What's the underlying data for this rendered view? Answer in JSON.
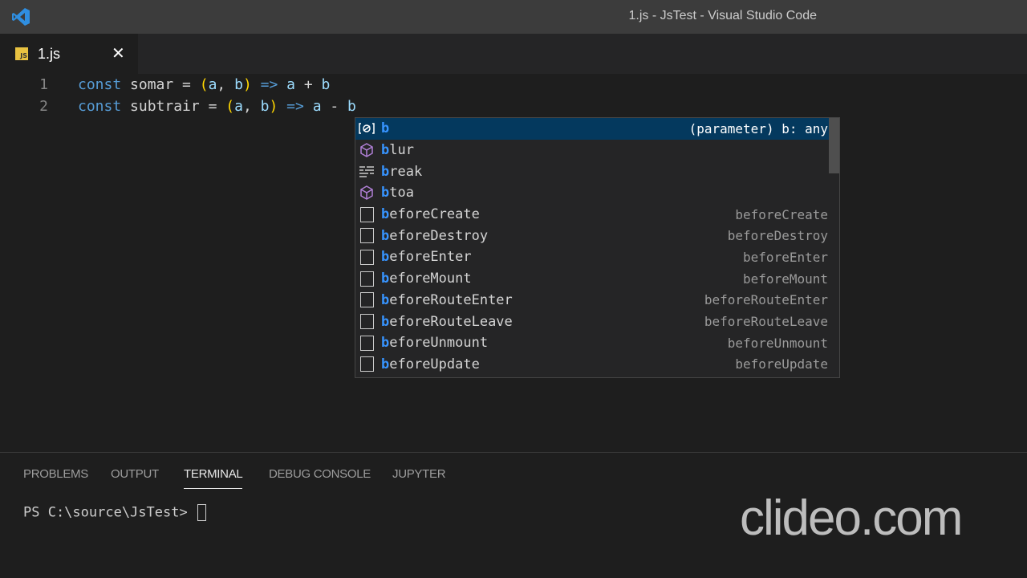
{
  "window": {
    "title": "1.js - JsTest - Visual Studio Code"
  },
  "tab": {
    "icon_text": "JS",
    "name": "1.js",
    "close": "✕"
  },
  "code": [
    {
      "num": "1",
      "tokens": [
        [
          "kw",
          "const"
        ],
        [
          "op",
          " "
        ],
        [
          "id",
          "somar"
        ],
        [
          "op",
          " = "
        ],
        [
          "p",
          "("
        ],
        [
          "v",
          "a"
        ],
        [
          "op",
          ", "
        ],
        [
          "v",
          "b"
        ],
        [
          "p",
          ")"
        ],
        [
          "op",
          " "
        ],
        [
          "kw",
          "=>"
        ],
        [
          "op",
          " "
        ],
        [
          "v",
          "a"
        ],
        [
          "op",
          " + "
        ],
        [
          "v",
          "b"
        ]
      ]
    },
    {
      "num": "2",
      "tokens": [
        [
          "kw",
          "const"
        ],
        [
          "op",
          " "
        ],
        [
          "id",
          "subtrair"
        ],
        [
          "op",
          " = "
        ],
        [
          "p",
          "("
        ],
        [
          "v",
          "a"
        ],
        [
          "op",
          ", "
        ],
        [
          "v",
          "b"
        ],
        [
          "p",
          ")"
        ],
        [
          "op",
          " "
        ],
        [
          "kw",
          "=>"
        ],
        [
          "op",
          " "
        ],
        [
          "v",
          "a"
        ],
        [
          "op",
          " - "
        ],
        [
          "v",
          "b"
        ]
      ]
    }
  ],
  "suggestions": [
    {
      "icon": "variable",
      "match": "b",
      "rest": "",
      "detail": "(parameter) b: any",
      "selected": true
    },
    {
      "icon": "module",
      "match": "b",
      "rest": "lur",
      "detail": ""
    },
    {
      "icon": "keyword",
      "match": "b",
      "rest": "reak",
      "detail": ""
    },
    {
      "icon": "module",
      "match": "b",
      "rest": "toa",
      "detail": ""
    },
    {
      "icon": "snippet",
      "match": "b",
      "rest": "eforeCreate",
      "detail": "beforeCreate"
    },
    {
      "icon": "snippet",
      "match": "b",
      "rest": "eforeDestroy",
      "detail": "beforeDestroy"
    },
    {
      "icon": "snippet",
      "match": "b",
      "rest": "eforeEnter",
      "detail": "beforeEnter"
    },
    {
      "icon": "snippet",
      "match": "b",
      "rest": "eforeMount",
      "detail": "beforeMount"
    },
    {
      "icon": "snippet",
      "match": "b",
      "rest": "eforeRouteEnter",
      "detail": "beforeRouteEnter"
    },
    {
      "icon": "snippet",
      "match": "b",
      "rest": "eforeRouteLeave",
      "detail": "beforeRouteLeave"
    },
    {
      "icon": "snippet",
      "match": "b",
      "rest": "eforeUnmount",
      "detail": "beforeUnmount"
    },
    {
      "icon": "snippet",
      "match": "b",
      "rest": "eforeUpdate",
      "detail": "beforeUpdate"
    }
  ],
  "panel": {
    "tabs": [
      "PROBLEMS",
      "OUTPUT",
      "TERMINAL",
      "DEBUG CONSOLE",
      "JUPYTER"
    ],
    "active": "TERMINAL",
    "prompt": "PS C:\\source\\JsTest> "
  },
  "watermark": "clideo.com"
}
